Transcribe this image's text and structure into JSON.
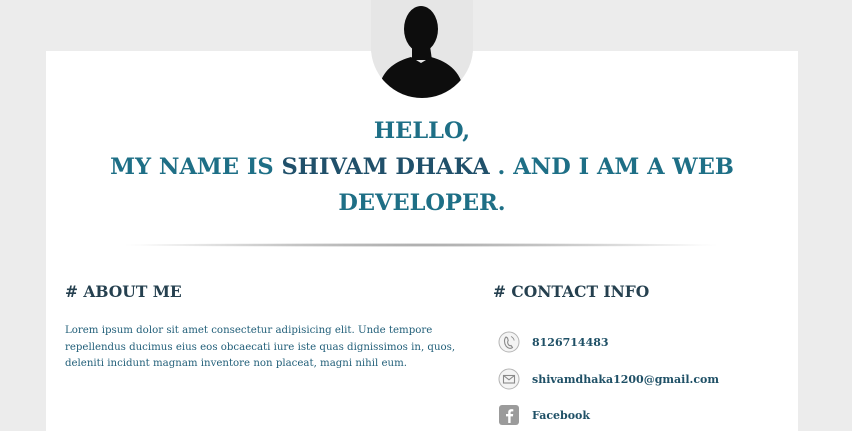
{
  "hero": {
    "hello": "HELLO,",
    "line2_prefix": "MY NAME IS ",
    "name": "SHIVAM DHAKA",
    "line2_suffix": " . AND I AM A WEB",
    "line3": "DEVELOPER."
  },
  "about": {
    "title": "# ABOUT ME",
    "text": "Lorem ipsum dolor sit amet consectetur adipisicing elit. Unde tempore repellendus ducimus eius eos obcaecati iure iste quas dignissimos in, quos, deleniti incidunt magnam inventore non placeat, magni nihil eum."
  },
  "contact": {
    "title": "# CONTACT INFO",
    "items": [
      {
        "icon": "phone-icon",
        "text": "8126714483"
      },
      {
        "icon": "email-icon",
        "text": "shivamdhaka1200@gmail.com"
      },
      {
        "icon": "facebook-icon",
        "text": "Facebook"
      }
    ]
  },
  "colors": {
    "background": "#ececec",
    "card": "#ffffff",
    "accent": "#1e6f86",
    "heading": "#25404f",
    "body_text": "#23607a"
  }
}
